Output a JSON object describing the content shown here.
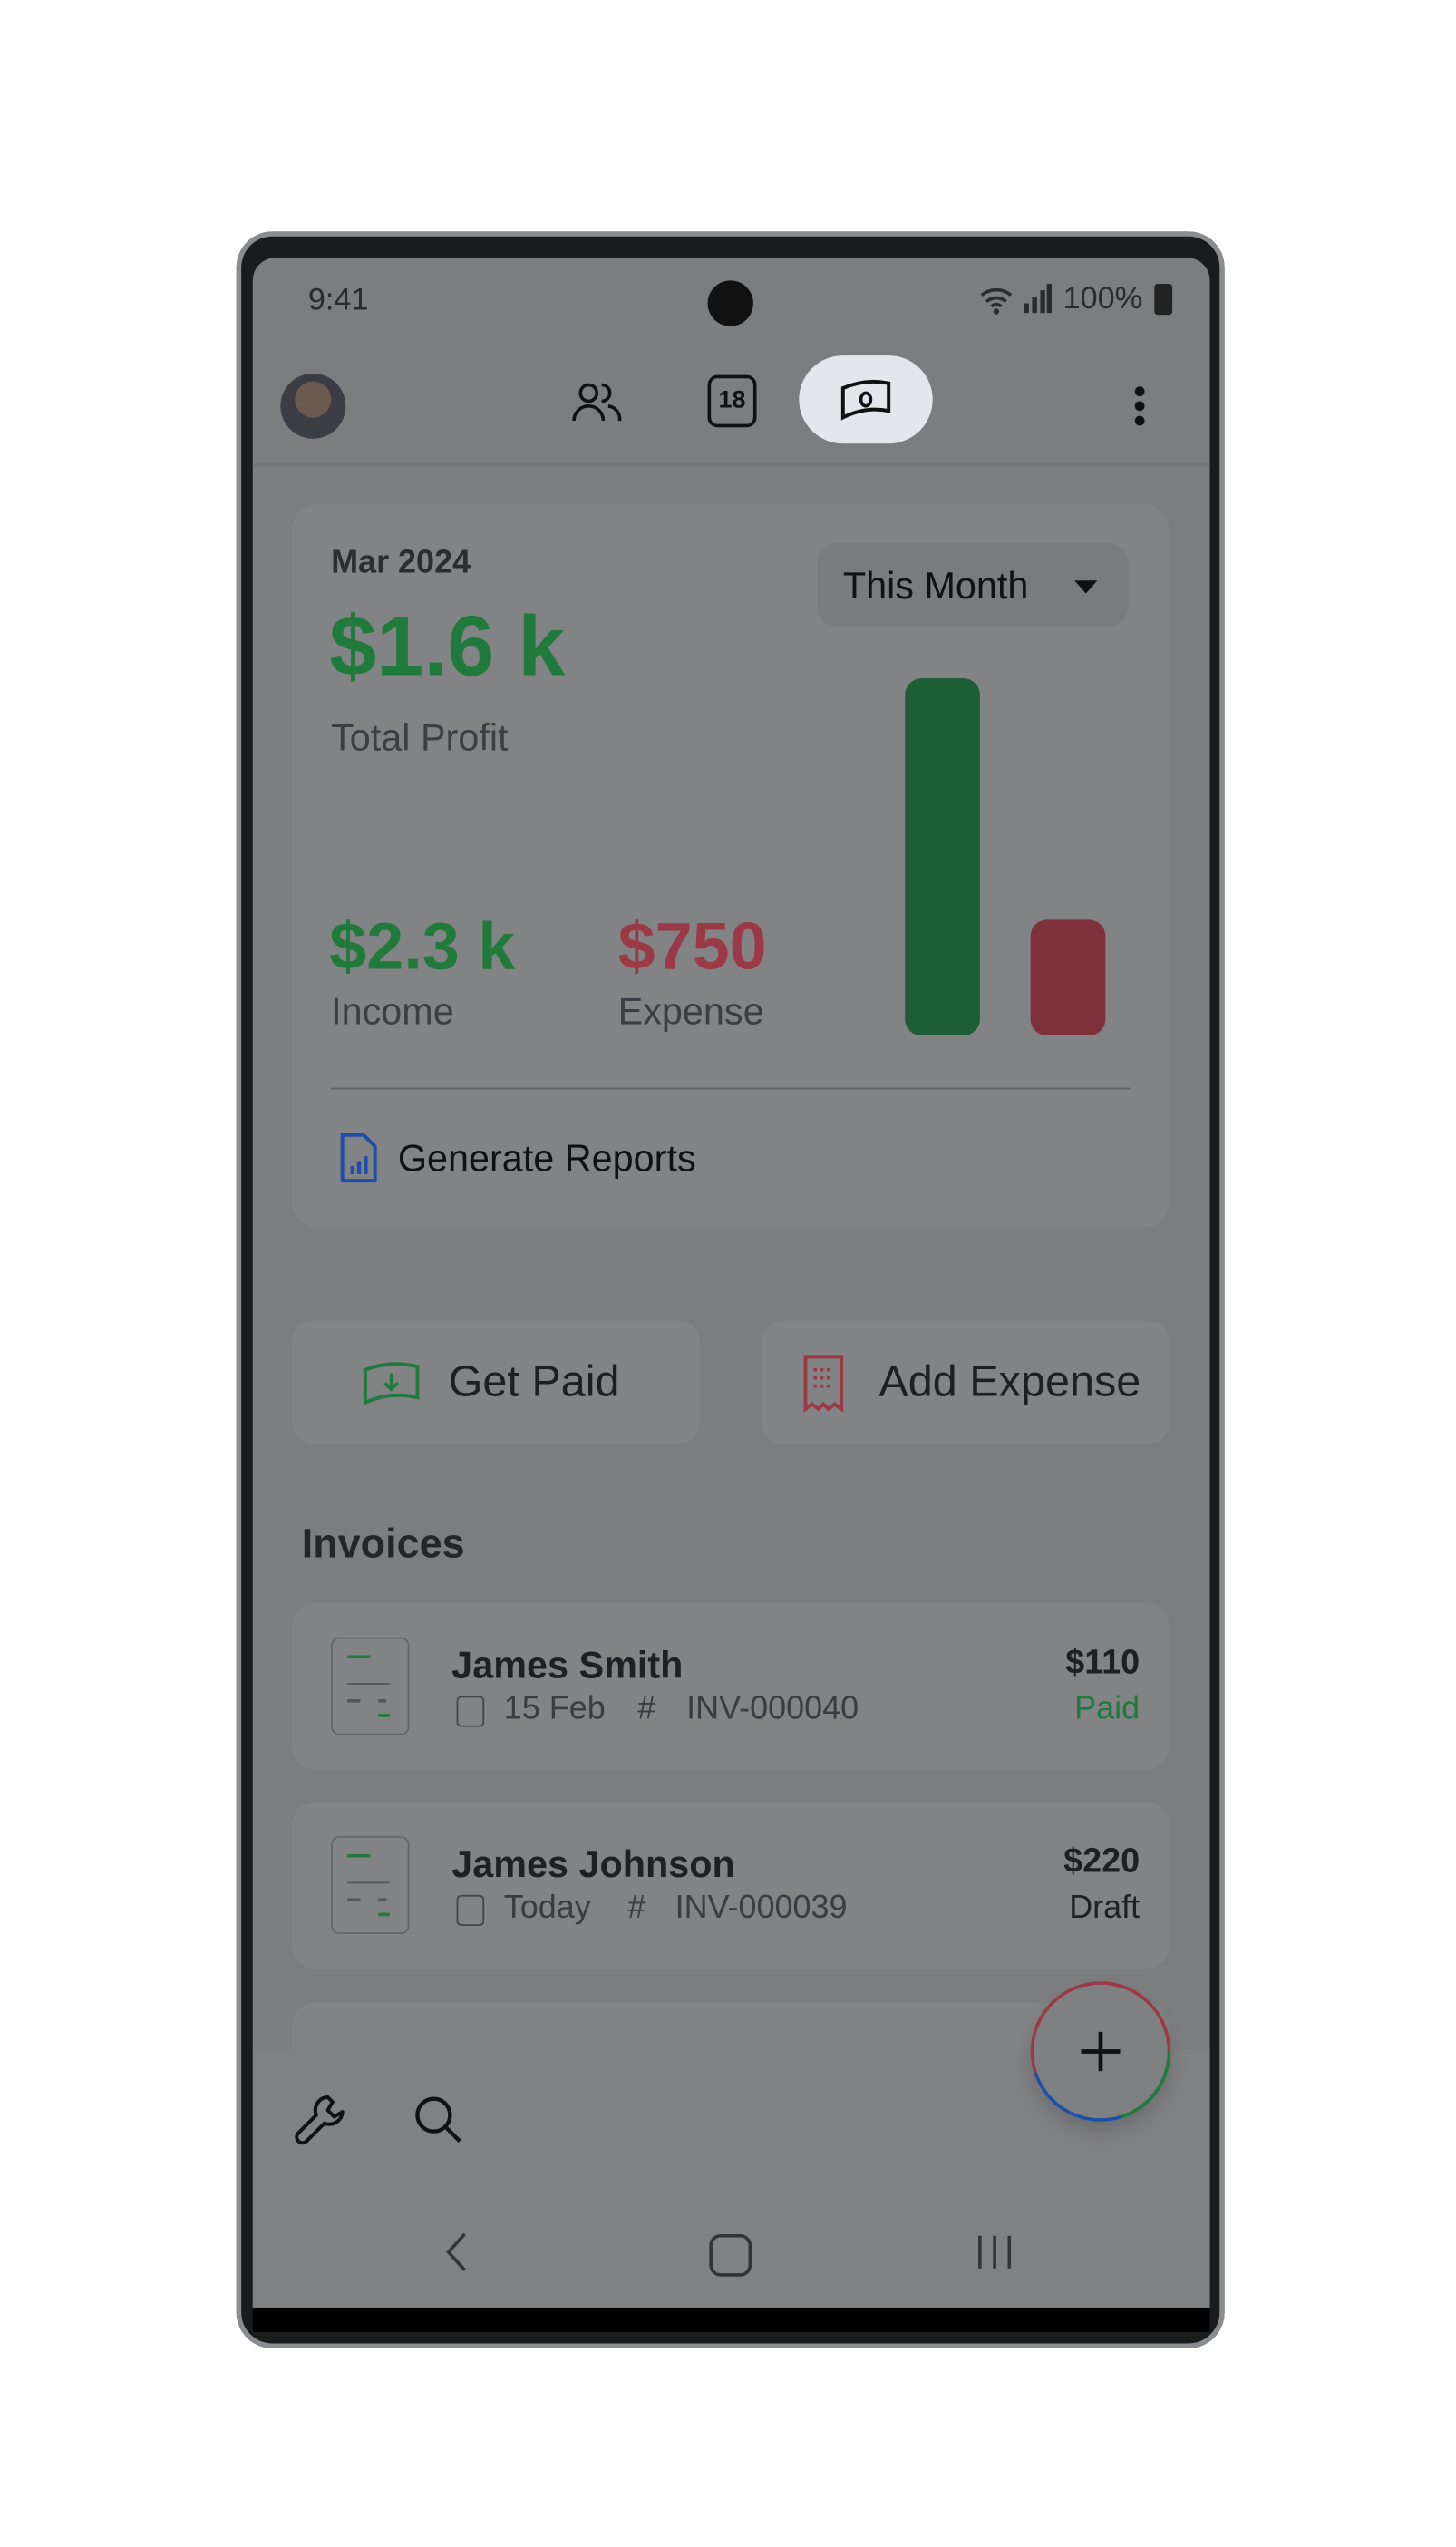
{
  "status_bar": {
    "time": "9:41",
    "battery": "100%"
  },
  "top_nav": {
    "tabs": [
      {
        "icon": "people-icon"
      },
      {
        "icon": "calendar-icon",
        "label": "18"
      },
      {
        "icon": "money-icon",
        "active": true
      }
    ]
  },
  "summary": {
    "period": "Mar 2024",
    "profit": "$1.6 k",
    "profit_label": "Total Profit",
    "range_select": "This Month",
    "income": "$2.3 k",
    "income_label": "Income",
    "expense": "$750",
    "expense_label": "Expense",
    "income_value": 2300,
    "expense_value": 750,
    "generate_reports": "Generate Reports"
  },
  "actions": {
    "get_paid": "Get Paid",
    "add_expense": "Add Expense"
  },
  "invoices": {
    "title": "Invoices",
    "items": [
      {
        "name": "James Smith",
        "date": "15 Feb",
        "number": "INV-000040",
        "amount": "$110",
        "status": "Paid"
      },
      {
        "name": "James Johnson",
        "date": "Today",
        "number": "INV-000039",
        "amount": "$220",
        "status": "Draft"
      }
    ]
  },
  "colors": {
    "income": "#1f7a3c",
    "expense": "#9b3a46",
    "green_bar": "#1e5e36",
    "red_bar": "#7f323c"
  }
}
